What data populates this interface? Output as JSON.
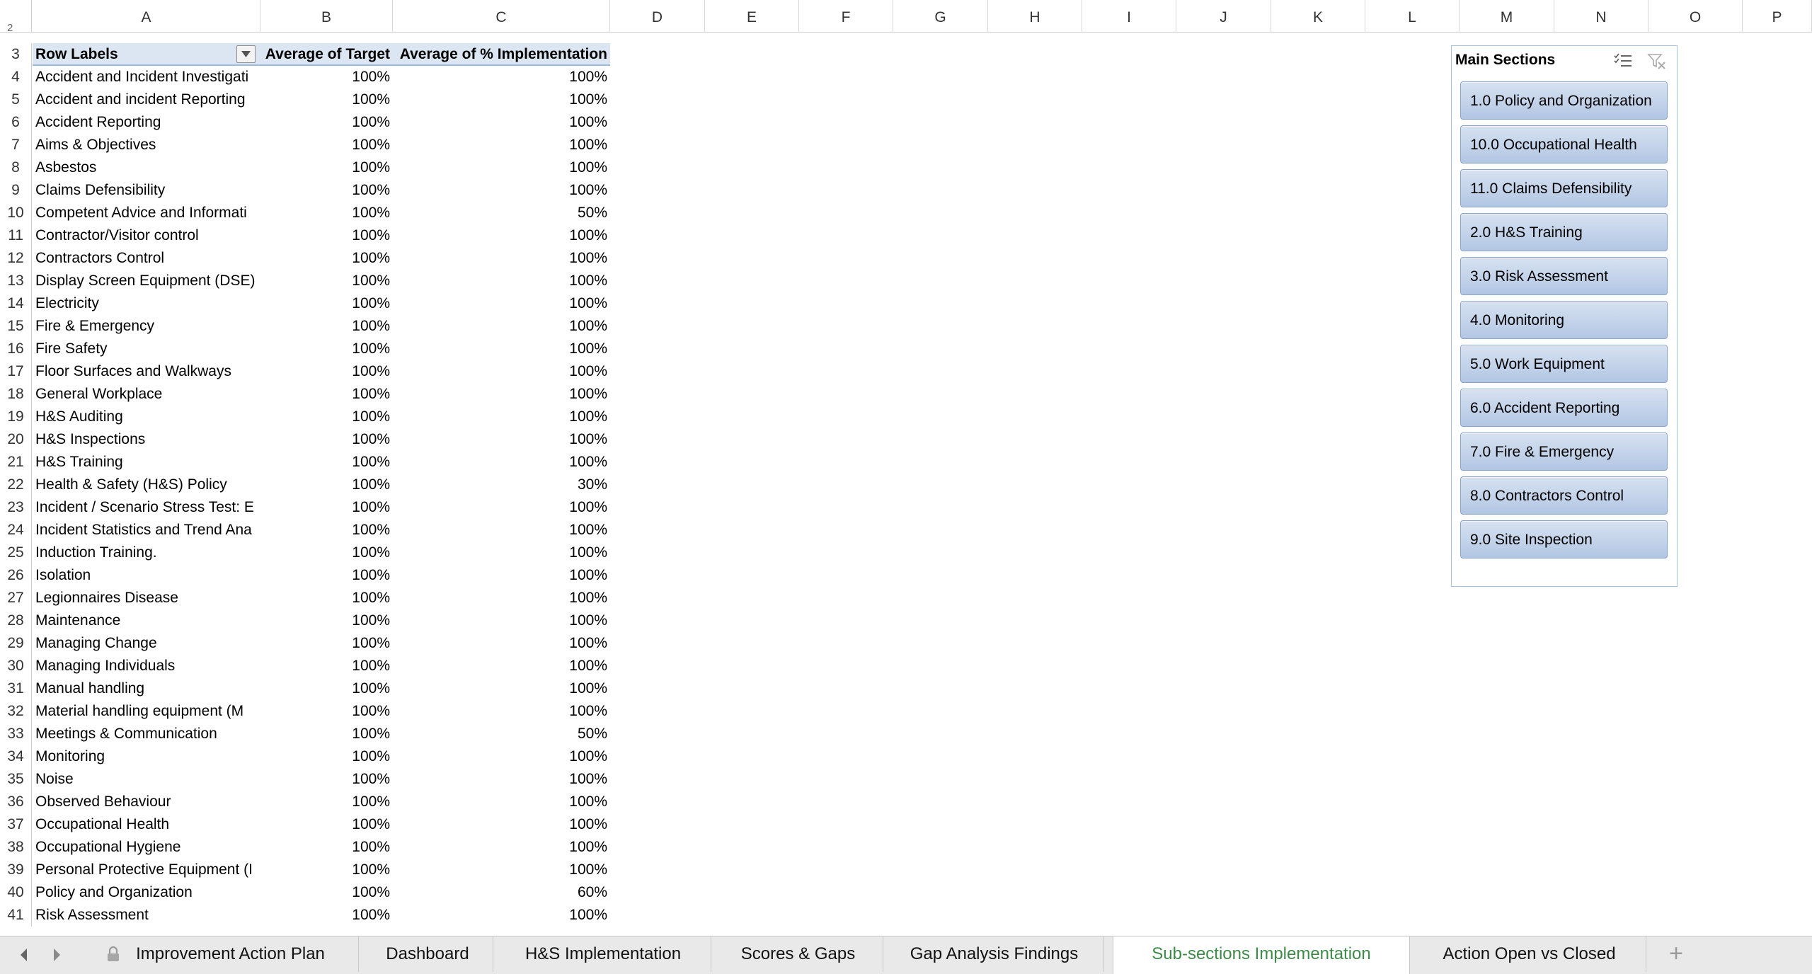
{
  "columns": [
    "A",
    "B",
    "C",
    "D",
    "E",
    "F",
    "G",
    "H",
    "I",
    "J",
    "K",
    "L",
    "M",
    "N",
    "O",
    "P"
  ],
  "top_row_fragment": "2",
  "pivot": {
    "header_row": "3",
    "headers": {
      "row_labels": "Row Labels",
      "avg_target": "Average of Target",
      "avg_impl": "Average of % Implementation"
    },
    "rows": [
      {
        "n": "4",
        "label": "Accident and Incident Investigati",
        "target": "100%",
        "impl": "100%"
      },
      {
        "n": "5",
        "label": "Accident and incident Reporting",
        "target": "100%",
        "impl": "100%"
      },
      {
        "n": "6",
        "label": "Accident Reporting",
        "target": "100%",
        "impl": "100%"
      },
      {
        "n": "7",
        "label": "Aims & Objectives",
        "target": "100%",
        "impl": "100%"
      },
      {
        "n": "8",
        "label": "Asbestos",
        "target": "100%",
        "impl": "100%"
      },
      {
        "n": "9",
        "label": "Claims Defensibility",
        "target": "100%",
        "impl": "100%"
      },
      {
        "n": "10",
        "label": "Competent Advice and Informati",
        "target": "100%",
        "impl": "50%"
      },
      {
        "n": "11",
        "label": "Contractor/Visitor control",
        "target": "100%",
        "impl": "100%"
      },
      {
        "n": "12",
        "label": "Contractors Control",
        "target": "100%",
        "impl": "100%"
      },
      {
        "n": "13",
        "label": "Display Screen Equipment (DSE)",
        "target": "100%",
        "impl": "100%"
      },
      {
        "n": "14",
        "label": "Electricity",
        "target": "100%",
        "impl": "100%"
      },
      {
        "n": "15",
        "label": "Fire & Emergency",
        "target": "100%",
        "impl": "100%"
      },
      {
        "n": "16",
        "label": "Fire Safety",
        "target": "100%",
        "impl": "100%"
      },
      {
        "n": "17",
        "label": "Floor Surfaces and Walkways",
        "target": "100%",
        "impl": "100%"
      },
      {
        "n": "18",
        "label": "General Workplace",
        "target": "100%",
        "impl": "100%"
      },
      {
        "n": "19",
        "label": "H&S Auditing",
        "target": "100%",
        "impl": "100%"
      },
      {
        "n": "20",
        "label": "H&S Inspections",
        "target": "100%",
        "impl": "100%"
      },
      {
        "n": "21",
        "label": "H&S Training",
        "target": "100%",
        "impl": "100%"
      },
      {
        "n": "22",
        "label": "Health & Safety (H&S) Policy",
        "target": "100%",
        "impl": "30%"
      },
      {
        "n": "23",
        "label": "Incident / Scenario Stress Test: E",
        "target": "100%",
        "impl": "100%"
      },
      {
        "n": "24",
        "label": "Incident Statistics and Trend Ana",
        "target": "100%",
        "impl": "100%"
      },
      {
        "n": "25",
        "label": "Induction Training.",
        "target": "100%",
        "impl": "100%"
      },
      {
        "n": "26",
        "label": "Isolation",
        "target": "100%",
        "impl": "100%"
      },
      {
        "n": "27",
        "label": "Legionnaires Disease",
        "target": "100%",
        "impl": "100%"
      },
      {
        "n": "28",
        "label": "Maintenance",
        "target": "100%",
        "impl": "100%"
      },
      {
        "n": "29",
        "label": "Managing Change",
        "target": "100%",
        "impl": "100%"
      },
      {
        "n": "30",
        "label": "Managing Individuals",
        "target": "100%",
        "impl": "100%"
      },
      {
        "n": "31",
        "label": "Manual handling",
        "target": "100%",
        "impl": "100%"
      },
      {
        "n": "32",
        "label": "Material handling equipment (M",
        "target": "100%",
        "impl": "100%"
      },
      {
        "n": "33",
        "label": "Meetings & Communication",
        "target": "100%",
        "impl": "50%"
      },
      {
        "n": "34",
        "label": "Monitoring",
        "target": "100%",
        "impl": "100%"
      },
      {
        "n": "35",
        "label": "Noise",
        "target": "100%",
        "impl": "100%"
      },
      {
        "n": "36",
        "label": "Observed Behaviour",
        "target": "100%",
        "impl": "100%"
      },
      {
        "n": "37",
        "label": "Occupational Health",
        "target": "100%",
        "impl": "100%"
      },
      {
        "n": "38",
        "label": "Occupational Hygiene",
        "target": "100%",
        "impl": "100%"
      },
      {
        "n": "39",
        "label": "Personal Protective Equipment (I",
        "target": "100%",
        "impl": "100%"
      },
      {
        "n": "40",
        "label": "Policy and Organization",
        "target": "100%",
        "impl": "60%"
      },
      {
        "n": "41",
        "label": "Risk Assessment",
        "target": "100%",
        "impl": "100%"
      }
    ]
  },
  "slicer": {
    "title": "Main Sections",
    "items": [
      "1.0 Policy and Organization",
      "10.0 Occupational Health",
      "11.0 Claims Defensibility",
      "2.0 H&S Training",
      "3.0 Risk Assessment",
      "4.0 Monitoring",
      "5.0 Work Equipment",
      "6.0 Accident Reporting",
      "7.0 Fire & Emergency",
      "8.0 Contractors Control",
      "9.0 Site Inspection"
    ]
  },
  "sheet_tabs": {
    "items": [
      "Improvement Action Plan",
      "Dashboard",
      "H&S Implementation",
      "Scores & Gaps",
      "Gap Analysis Findings",
      "Sub-sections Implementation",
      "Action Open vs Closed"
    ],
    "active": "Sub-sections Implementation",
    "active_color": "#3e8a49",
    "add_label": "+"
  },
  "icons": {
    "filter_dropdown": "dropdown-arrow-icon",
    "multi_select": "multi-select-icon",
    "clear_filter": "clear-filter-icon",
    "tab_prev": "chevron-left-icon",
    "tab_next": "chevron-right-icon",
    "protected_sheet": "lock-icon"
  }
}
